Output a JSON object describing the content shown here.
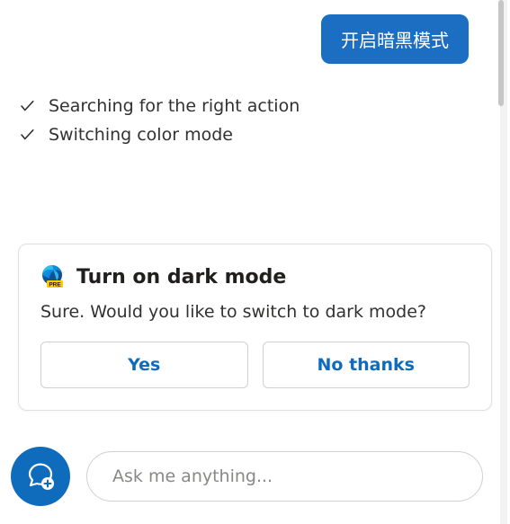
{
  "user_message": "开启暗黑模式",
  "status_items": [
    "Searching for the right action",
    "Switching color mode"
  ],
  "card": {
    "title": "Turn on dark mode",
    "body": "Sure. Would you like to switch to dark mode?",
    "yes_label": "Yes",
    "no_label": "No thanks",
    "icon_badge": "PRE"
  },
  "input": {
    "placeholder": "Ask me anything..."
  },
  "colors": {
    "accent": "#0f6cbd",
    "user_bubble": "#1b6ec2"
  }
}
